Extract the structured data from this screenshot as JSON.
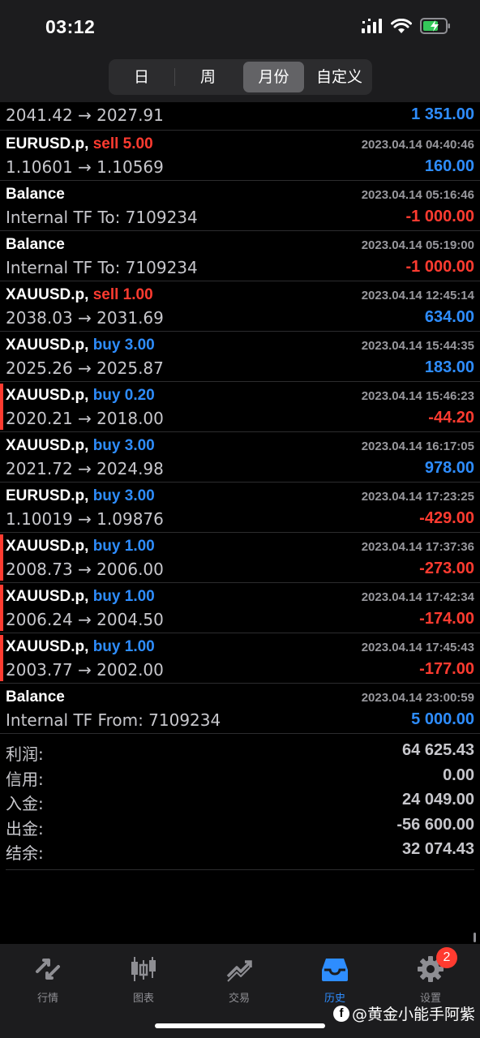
{
  "status_bar": {
    "time": "03:12"
  },
  "period_tabs": [
    "日",
    "周",
    "月份",
    "自定义"
  ],
  "active_period": "月份",
  "rows": [
    {
      "prices": "2041.42 → 2027.91",
      "profit": "1 351.00",
      "positive": true,
      "partial": true
    },
    {
      "symbol": "EURUSD.p,",
      "side": "sell",
      "volume": "5.00",
      "datetime": "2023.04.14 04:40:46",
      "prices": "1.10601 → 1.10569",
      "profit": "160.00",
      "positive": true
    },
    {
      "symbol": "Balance",
      "datetime": "2023.04.14 05:16:46",
      "prices": "Internal TF To: 7109234",
      "profit": "-1 000.00",
      "positive": false,
      "balance": true
    },
    {
      "symbol": "Balance",
      "datetime": "2023.04.14 05:19:00",
      "prices": "Internal TF To: 7109234",
      "profit": "-1 000.00",
      "positive": false,
      "balance": true
    },
    {
      "symbol": "XAUUSD.p,",
      "side": "sell",
      "volume": "1.00",
      "datetime": "2023.04.14 12:45:14",
      "prices": "2038.03 → 2031.69",
      "profit": "634.00",
      "positive": true
    },
    {
      "symbol": "XAUUSD.p,",
      "side": "buy",
      "volume": "3.00",
      "datetime": "2023.04.14 15:44:35",
      "prices": "2025.26 → 2025.87",
      "profit": "183.00",
      "positive": true
    },
    {
      "symbol": "XAUUSD.p,",
      "side": "buy",
      "volume": "0.20",
      "datetime": "2023.04.14 15:46:23",
      "prices": "2020.21 → 2018.00",
      "profit": "-44.20",
      "positive": false,
      "loss_marker": true
    },
    {
      "symbol": "XAUUSD.p,",
      "side": "buy",
      "volume": "3.00",
      "datetime": "2023.04.14 16:17:05",
      "prices": "2021.72 → 2024.98",
      "profit": "978.00",
      "positive": true
    },
    {
      "symbol": "EURUSD.p,",
      "side": "buy",
      "volume": "3.00",
      "datetime": "2023.04.14 17:23:25",
      "prices": "1.10019 → 1.09876",
      "profit": "-429.00",
      "positive": false
    },
    {
      "symbol": "XAUUSD.p,",
      "side": "buy",
      "volume": "1.00",
      "datetime": "2023.04.14 17:37:36",
      "prices": "2008.73 → 2006.00",
      "profit": "-273.00",
      "positive": false,
      "loss_marker": true
    },
    {
      "symbol": "XAUUSD.p,",
      "side": "buy",
      "volume": "1.00",
      "datetime": "2023.04.14 17:42:34",
      "prices": "2006.24 → 2004.50",
      "profit": "-174.00",
      "positive": false,
      "loss_marker": true
    },
    {
      "symbol": "XAUUSD.p,",
      "side": "buy",
      "volume": "1.00",
      "datetime": "2023.04.14 17:45:43",
      "prices": "2003.77 → 2002.00",
      "profit": "-177.00",
      "positive": false,
      "loss_marker": true
    },
    {
      "symbol": "Balance",
      "datetime": "2023.04.14 23:00:59",
      "prices": "Internal TF From: 7109234",
      "profit": "5 000.00",
      "positive": true,
      "balance": true
    }
  ],
  "summary": [
    {
      "label": "利润:",
      "value": "64 625.43"
    },
    {
      "label": "信用:",
      "value": "0.00"
    },
    {
      "label": "入金:",
      "value": "24 049.00"
    },
    {
      "label": "出金:",
      "value": "-56 600.00"
    },
    {
      "label": "结余:",
      "value": "32 074.43"
    }
  ],
  "tabbar": [
    {
      "label": "行情",
      "icon": "quotes-icon"
    },
    {
      "label": "图表",
      "icon": "chart-icon"
    },
    {
      "label": "交易",
      "icon": "trade-icon"
    },
    {
      "label": "历史",
      "icon": "history-icon",
      "active": true
    },
    {
      "label": "设置",
      "icon": "settings-icon",
      "badge": "2"
    }
  ],
  "watermark": "@黄金小能手阿紫",
  "colors": {
    "profit": "#2e8dff",
    "loss": "#ff3b30",
    "active_tab": "#2e8dff",
    "background": "#000000"
  }
}
